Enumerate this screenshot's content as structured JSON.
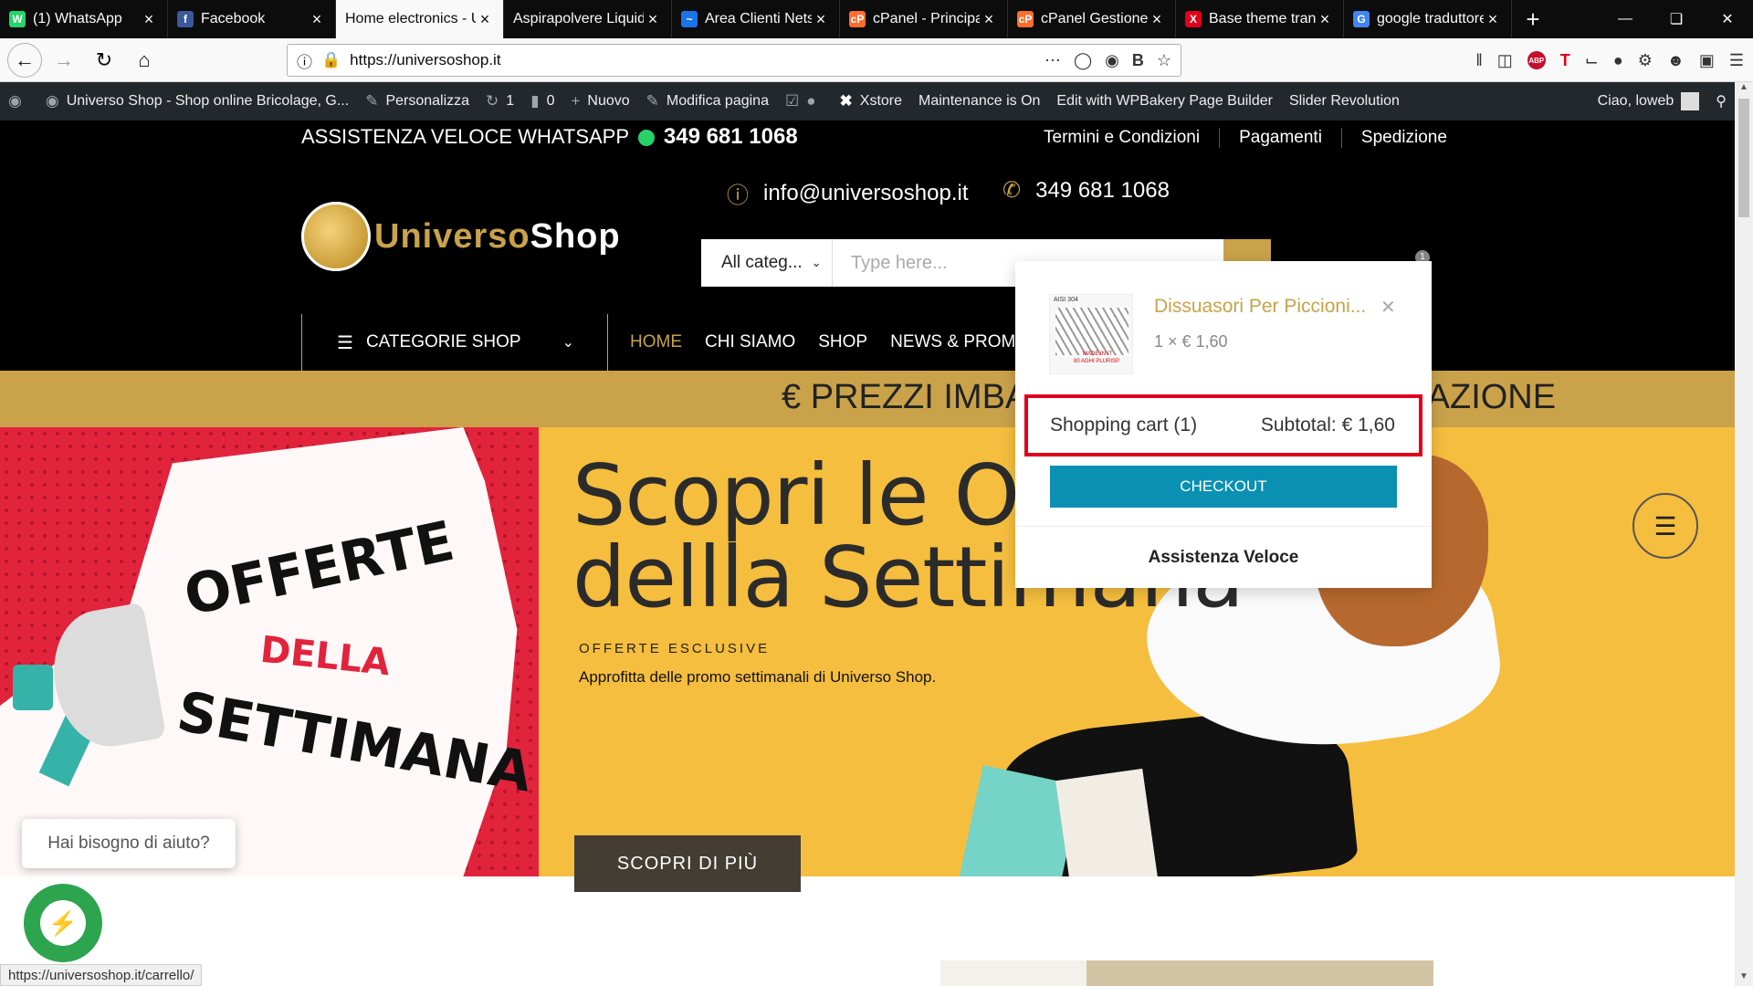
{
  "browser": {
    "tabs": [
      {
        "label": "(1) WhatsApp",
        "icon": "whatsapp-icon",
        "color": "#25d366",
        "glyph": "W"
      },
      {
        "label": "Facebook",
        "icon": "facebook-icon",
        "color": "#3b5998",
        "glyph": "f"
      },
      {
        "label": "Home electronics - U",
        "icon": "",
        "color": "",
        "glyph": ""
      },
      {
        "label": "Aspirapolvere Liquid",
        "icon": "",
        "color": "",
        "glyph": ""
      },
      {
        "label": "Area Clienti Netso",
        "icon": "netsons-icon",
        "color": "#1a73e8",
        "glyph": "~"
      },
      {
        "label": "cPanel - Principa",
        "icon": "cpanel-icon",
        "color": "#ff6c2c",
        "glyph": "cP"
      },
      {
        "label": "cPanel Gestione",
        "icon": "cpanel-icon",
        "color": "#ff6c2c",
        "glyph": "cP"
      },
      {
        "label": "Base theme trans",
        "icon": "x-icon",
        "color": "#e0001b",
        "glyph": "X"
      },
      {
        "label": "google traduttore",
        "icon": "google-icon",
        "color": "#4285f4",
        "glyph": "G"
      }
    ],
    "active_tab": 2,
    "url": "https://universoshop.it",
    "status_url": "https://universoshop.it/carrello/"
  },
  "adminbar": {
    "site_name": "Universo Shop - Shop online Bricolage, G...",
    "customize": "Personalizza",
    "updates_count": "1",
    "comments_count": "0",
    "new_label": "Nuovo",
    "edit_page": "Modifica pagina",
    "xstore": "Xstore",
    "maintenance": "Maintenance is On",
    "wpbakery": "Edit with WPBakery Page Builder",
    "slider": "Slider Revolution",
    "greeting": "Ciao, loweb"
  },
  "topbar": {
    "assist_label": "ASSISTENZA VELOCE WHATSAPP",
    "phone": "349 681 1068",
    "links": [
      "Termini e Condizioni",
      "Pagamenti",
      "Spedizione"
    ]
  },
  "header": {
    "logo_text_1": "Universo",
    "logo_text_2": "Shop",
    "email": "info@universoshop.it",
    "phone": "349 681 1068",
    "search_category": "All categ...",
    "search_placeholder": "Type here...",
    "cart_count": "1"
  },
  "menu": {
    "categories_label": "CATEGORIE SHOP",
    "items": [
      "HOME",
      "CHI SIAMO",
      "SHOP",
      "NEWS & PROMO"
    ]
  },
  "strip": {
    "text": "€ PREZZI IMBATTIBILI SENZA REGISTRAZIONE"
  },
  "hero": {
    "promo_1": "OFFERTE",
    "promo_2": "DELLA",
    "promo_3": "SETTIMANA",
    "title": "Scopri le Offerte\ndellla Settimana",
    "eyebrow": "OFFERTE ESCLUSIVE",
    "description": "Approfitta delle promo settimanali di Universo Shop.",
    "cta": "SCOPRI DI PIÙ"
  },
  "cart_dropdown": {
    "item_name": "Dissuasori Per Piccioni...",
    "item_qty_price": "1 × € 1,60",
    "summary_label": "Shopping cart (1)",
    "subtotal": "Subtotal: € 1,60",
    "checkout": "CHECKOUT",
    "assist": "Assistenza Veloce",
    "thumb_text_1": "AISI 304",
    "thumb_text_2": "MADE IN IT",
    "thumb_text_3": "80 AGHI PLURISP."
  },
  "chat": {
    "help": "Hai bisogno di aiuto?"
  },
  "colors": {
    "gold": "#c9a24a",
    "checkout": "#0a90b2",
    "highlight": "#e0001b",
    "hero_bg": "#f6be3e"
  }
}
